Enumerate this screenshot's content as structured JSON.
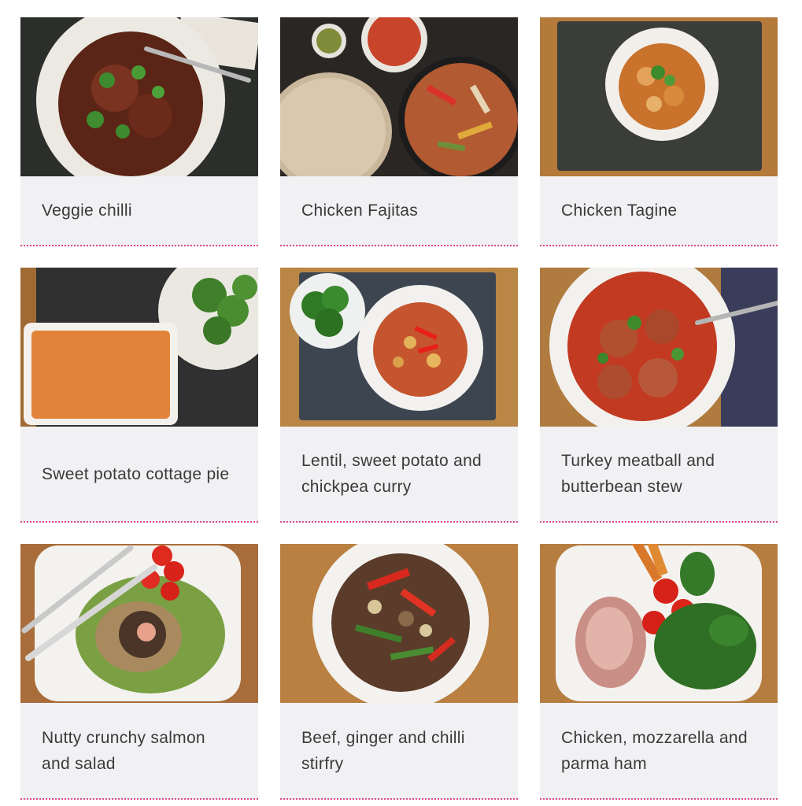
{
  "recipes": [
    {
      "title": "Veggie chilli"
    },
    {
      "title": "Chicken Fajitas"
    },
    {
      "title": "Chicken Tagine"
    },
    {
      "title": "Sweet potato cottage pie"
    },
    {
      "title": "Lentil, sweet potato and chickpea curry"
    },
    {
      "title": "Turkey meatball and butterbean stew"
    },
    {
      "title": "Nutty crunchy salmon and salad"
    },
    {
      "title": "Beef, ginger and chilli stirfry"
    },
    {
      "title": "Chicken, mozzarella and parma ham"
    }
  ],
  "colors": {
    "card_background": "#f1f0f3",
    "divider": "#e0468a",
    "text": "#3a3a3a"
  }
}
